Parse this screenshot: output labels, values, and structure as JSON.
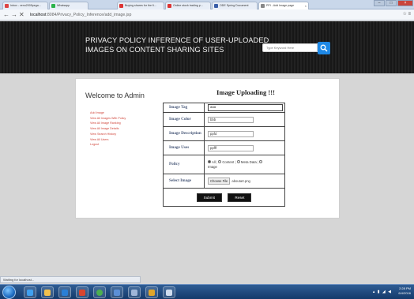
{
  "browser": {
    "tabs": [
      {
        "label": "Inbox - venu2005pega..."
      },
      {
        "label": "Whatsapp"
      },
      {
        "label": "Buying shares for the fi..."
      },
      {
        "label": "Online stock trading p..."
      },
      {
        "label": "ODE Spring Document"
      },
      {
        "label": "PPI - Add Image page"
      }
    ],
    "address": {
      "host": "localhost",
      "path": ":8084/Privacy_Policy_Inference/add_image.jsp"
    }
  },
  "header": {
    "title": "PRIVACY POLICY INFERENCE OF USER-UPLOADED IMAGES ON CONTENT SHARING SITES",
    "search_placeholder": "Type Keyword Here"
  },
  "sidebar": {
    "welcome": "Welcome to Admin",
    "links": [
      "Add Image",
      "View All Images With Policy",
      "View All Image Ranking",
      "View All Image Details",
      "View Search History",
      "View All Users",
      "Logout"
    ]
  },
  "form": {
    "title": "Image Uploading !!!",
    "rows": {
      "tag": {
        "label": "Image Tag",
        "value": "aaa"
      },
      "color": {
        "label": "Image Color",
        "value": "bbb"
      },
      "description": {
        "label": "Image Description",
        "value": "ppfd"
      },
      "uses": {
        "label": "Image Uses",
        "value": "ppfff"
      },
      "policy": {
        "label": "Policy",
        "options": [
          "All",
          "Content",
          "Meta Data",
          "Image"
        ],
        "selected": "All"
      },
      "image": {
        "label": "Select Image",
        "button": "Choose File",
        "file": "aboutart.png"
      }
    },
    "submit": "Submit",
    "reset": "Reset"
  },
  "status_bar": "Waiting for localhost...",
  "clock": {
    "time": "2:28 PM",
    "date": "6/4/2016"
  },
  "colors": {
    "link": "#d0453a",
    "header_bg": "#1b1b1b",
    "search_button": "#1e88e5"
  }
}
